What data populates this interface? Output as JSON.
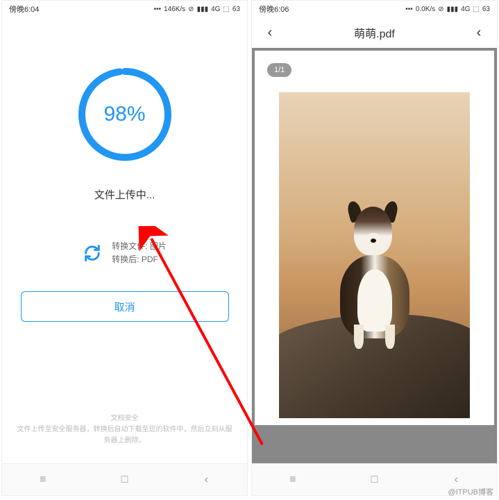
{
  "left": {
    "status": {
      "time": "傍晚6:04",
      "speed": "146K/s",
      "network": "4G",
      "battery": "63"
    },
    "progress": {
      "percent": "98%",
      "value": 98
    },
    "upload_status": "文件上传中...",
    "convert": {
      "source_label": "转换文件: ",
      "source_value": "图片",
      "target_label": "转换后: ",
      "target_value": "PDF"
    },
    "cancel_label": "取消",
    "security": {
      "title": "文档安全",
      "desc": "文件上传至安全服务器，转换后自动下载至您的软件中，然后立刻从服务器上删除。"
    }
  },
  "right": {
    "status": {
      "time": "傍晚6:06",
      "speed": "0.0K/s",
      "network": "4G",
      "battery": "63"
    },
    "title": "萌萌.pdf",
    "page_indicator": "1/1"
  },
  "nav": {
    "recent": "≡",
    "home": "□",
    "back": "‹"
  },
  "watermark": "@ITPUB博客"
}
